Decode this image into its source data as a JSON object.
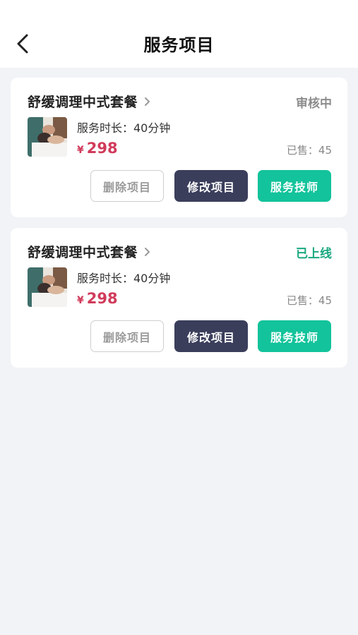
{
  "header": {
    "title": "服务项目"
  },
  "items": [
    {
      "name": "舒缓调理中式套餐",
      "status": "审核中",
      "status_color": "#8c8c8c",
      "duration": "服务时长：40分钟",
      "currency": "¥",
      "price": "298",
      "sold": "已售：45",
      "buttons": {
        "delete": "删除项目",
        "edit": "修改项目",
        "tech": "服务技师"
      }
    },
    {
      "name": "舒缓调理中式套餐",
      "status": "已上线",
      "status_color": "#1aa87f",
      "duration": "服务时长：40分钟",
      "currency": "¥",
      "price": "298",
      "sold": "已售：45",
      "buttons": {
        "delete": "删除项目",
        "edit": "修改项目",
        "tech": "服务技师"
      }
    }
  ],
  "colors": {
    "price": "#d13b5b",
    "primary_dark": "#3b3e5b",
    "accent_green": "#13c39b"
  }
}
